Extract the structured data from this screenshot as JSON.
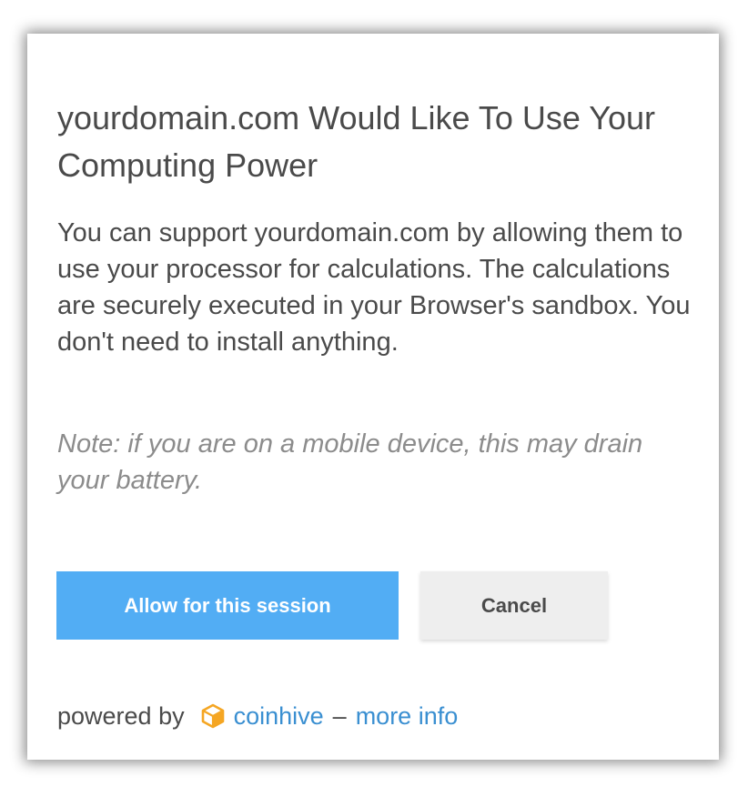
{
  "dialog": {
    "title": "yourdomain.com Would Like To Use Your Computing Power",
    "body": "You can support yourdomain.com by allowing them to use your processor for calculations. The calculations are securely executed in your Browser's sandbox. You don't need to install anything.",
    "note": "Note: if you are on a mobile device, this may drain your battery."
  },
  "buttons": {
    "allow_label": "Allow for this session",
    "cancel_label": "Cancel"
  },
  "footer": {
    "powered_by": "powered by",
    "brand_icon": "cube-icon",
    "brand_link": "coinhive",
    "separator": "–",
    "more_info_link": "more info"
  },
  "colors": {
    "primary_button": "#52adf4",
    "secondary_button": "#eeeeee",
    "link": "#3a8fd1",
    "brand_icon": "#f5a623",
    "text": "#4a4a4a",
    "note_text": "#8c8c8c"
  }
}
